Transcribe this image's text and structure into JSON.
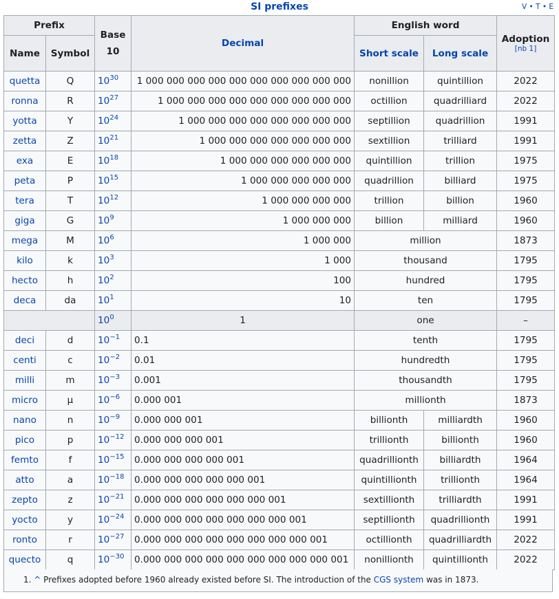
{
  "title": "SI prefixes",
  "vte": "V • T • E",
  "headers": {
    "prefix": "Prefix",
    "name": "Name",
    "symbol": "Symbol",
    "base10": "Base 10",
    "decimal": "Decimal",
    "english": "English word",
    "short": "Short scale",
    "long": "Long scale",
    "adoption": "Adoption",
    "note": "[nb 1]"
  },
  "rows": [
    {
      "name": "quetta",
      "symbol": "Q",
      "exp": "30",
      "decimal": "1 000 000 000 000 000 000 000 000 000 000",
      "short": "nonillion",
      "long": "quintillion",
      "year": "2022"
    },
    {
      "name": "ronna",
      "symbol": "R",
      "exp": "27",
      "decimal": "1 000 000 000 000 000 000 000 000 000",
      "short": "octillion",
      "long": "quadrilliard",
      "year": "2022"
    },
    {
      "name": "yotta",
      "symbol": "Y",
      "exp": "24",
      "decimal": "1 000 000 000 000 000 000 000 000",
      "short": "septillion",
      "long": "quadrillion",
      "year": "1991"
    },
    {
      "name": "zetta",
      "symbol": "Z",
      "exp": "21",
      "decimal": "1 000 000 000 000 000 000 000",
      "short": "sextillion",
      "long": "trilliard",
      "year": "1991"
    },
    {
      "name": "exa",
      "symbol": "E",
      "exp": "18",
      "decimal": "1 000 000 000 000 000 000",
      "short": "quintillion",
      "long": "trillion",
      "year": "1975"
    },
    {
      "name": "peta",
      "symbol": "P",
      "exp": "15",
      "decimal": "1 000 000 000 000 000",
      "short": "quadrillion",
      "long": "billiard",
      "year": "1975"
    },
    {
      "name": "tera",
      "symbol": "T",
      "exp": "12",
      "decimal": "1 000 000 000 000",
      "short": "trillion",
      "long": "billion",
      "year": "1960"
    },
    {
      "name": "giga",
      "symbol": "G",
      "exp": "9",
      "decimal": "1 000 000 000",
      "short": "billion",
      "long": "milliard",
      "year": "1960"
    },
    {
      "name": "mega",
      "symbol": "M",
      "exp": "6",
      "decimal": "1 000 000",
      "short": "million",
      "long": "million",
      "year": "1873"
    },
    {
      "name": "kilo",
      "symbol": "k",
      "exp": "3",
      "decimal": "1 000",
      "short": "thousand",
      "long": "thousand",
      "year": "1795"
    },
    {
      "name": "hecto",
      "symbol": "h",
      "exp": "2",
      "decimal": "100",
      "short": "hundred",
      "long": "hundred",
      "year": "1795"
    },
    {
      "name": "deca",
      "symbol": "da",
      "exp": "1",
      "decimal": "10",
      "short": "ten",
      "long": "ten",
      "year": "1795"
    },
    {
      "name": "",
      "symbol": "",
      "exp": "0",
      "decimal": "1",
      "short": "one",
      "long": "one",
      "year": "–"
    },
    {
      "name": "deci",
      "symbol": "d",
      "exp": "−1",
      "decimal": "0.1",
      "short": "tenth",
      "long": "tenth",
      "year": "1795"
    },
    {
      "name": "centi",
      "symbol": "c",
      "exp": "−2",
      "decimal": "0.01",
      "short": "hundredth",
      "long": "hundredth",
      "year": "1795"
    },
    {
      "name": "milli",
      "symbol": "m",
      "exp": "−3",
      "decimal": "0.001",
      "short": "thousandth",
      "long": "thousandth",
      "year": "1795"
    },
    {
      "name": "micro",
      "symbol": "μ",
      "exp": "−6",
      "decimal": "0.000 001",
      "short": "millionth",
      "long": "millionth",
      "year": "1873"
    },
    {
      "name": "nano",
      "symbol": "n",
      "exp": "−9",
      "decimal": "0.000 000 001",
      "short": "billionth",
      "long": "milliardth",
      "year": "1960"
    },
    {
      "name": "pico",
      "symbol": "p",
      "exp": "−12",
      "decimal": "0.000 000 000 001",
      "short": "trillionth",
      "long": "billionth",
      "year": "1960"
    },
    {
      "name": "femto",
      "symbol": "f",
      "exp": "−15",
      "decimal": "0.000 000 000 000 001",
      "short": "quadrillionth",
      "long": "billiardth",
      "year": "1964"
    },
    {
      "name": "atto",
      "symbol": "a",
      "exp": "−18",
      "decimal": "0.000 000 000 000 000 001",
      "short": "quintillionth",
      "long": "trillionth",
      "year": "1964"
    },
    {
      "name": "zepto",
      "symbol": "z",
      "exp": "−21",
      "decimal": "0.000 000 000 000 000 000 001",
      "short": "sextillionth",
      "long": "trilliardth",
      "year": "1991"
    },
    {
      "name": "yocto",
      "symbol": "y",
      "exp": "−24",
      "decimal": "0.000 000 000 000 000 000 000 001",
      "short": "septillionth",
      "long": "quadrillionth",
      "year": "1991"
    },
    {
      "name": "ronto",
      "symbol": "r",
      "exp": "−27",
      "decimal": "0.000 000 000 000 000 000 000 000 001",
      "short": "octillionth",
      "long": "quadrilliardth",
      "year": "2022"
    },
    {
      "name": "quecto",
      "symbol": "q",
      "exp": "−30",
      "decimal": "0.000 000 000 000 000 000 000 000 000 001",
      "short": "nonillionth",
      "long": "quintillionth",
      "year": "2022"
    }
  ],
  "footnote": {
    "num": "1.",
    "caret": "^",
    "text1": "Prefixes adopted before 1960 already existed before SI. The introduction of the ",
    "link": "CGS system",
    "text2": " was in 1873."
  }
}
